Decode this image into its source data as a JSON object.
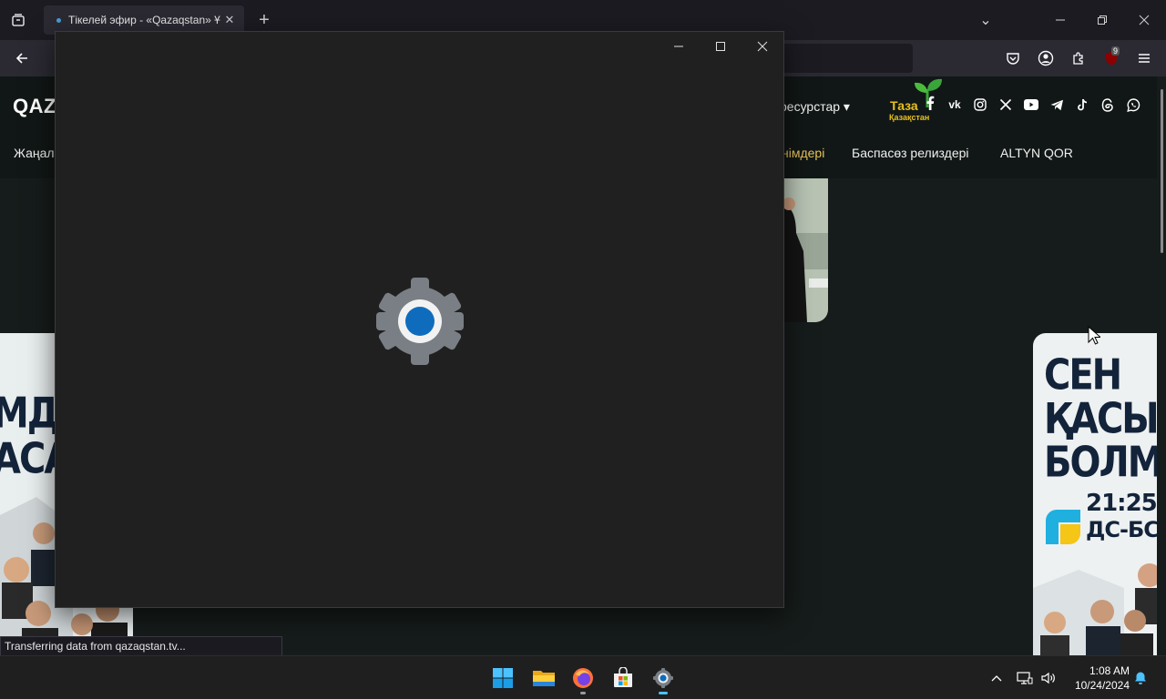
{
  "browser": {
    "tab": {
      "title": "Тікелей эфир - «Qazaqstan» Ұ",
      "close": "✕"
    },
    "new_tab": "+",
    "list_tabs": "⌄",
    "window": {
      "minimize": "—",
      "restore": "❐",
      "close": "✕"
    },
    "extension_badge": "9",
    "status_text": "Transferring data from qazaqstan.tv..."
  },
  "site": {
    "logo": "QAZ",
    "resources_menu": "ресурстар ▾",
    "eco_logo": {
      "line1": "Таза",
      "line2": "Қазақстан"
    },
    "nav": [
      "Жаңал",
      "німдері",
      "Баспасөз релиздері",
      "ALTYN QOR"
    ],
    "social_icons": [
      "facebook-icon",
      "vk-icon",
      "instagram-icon",
      "x-icon",
      "youtube-icon",
      "telegram-icon",
      "tiktok-icon",
      "threads-icon",
      "whatsapp-icon"
    ],
    "left_banner": {
      "lines": [
        "МД",
        "АСА"
      ]
    },
    "right_banner": {
      "lines": [
        "СЕН",
        "ҚАСЫМ",
        "БОЛМАС"
      ],
      "time": "21:25",
      "days": "ДС-БС"
    }
  },
  "settings_window": {
    "minimize": "—",
    "maximize": "☐",
    "close": "✕",
    "accent": "#0f6cbd"
  },
  "taskbar": {
    "apps": [
      "start-icon",
      "file-explorer-icon",
      "firefox-icon",
      "microsoft-store-icon",
      "settings-icon"
    ],
    "time": "1:08 AM",
    "date": "10/24/2024"
  }
}
